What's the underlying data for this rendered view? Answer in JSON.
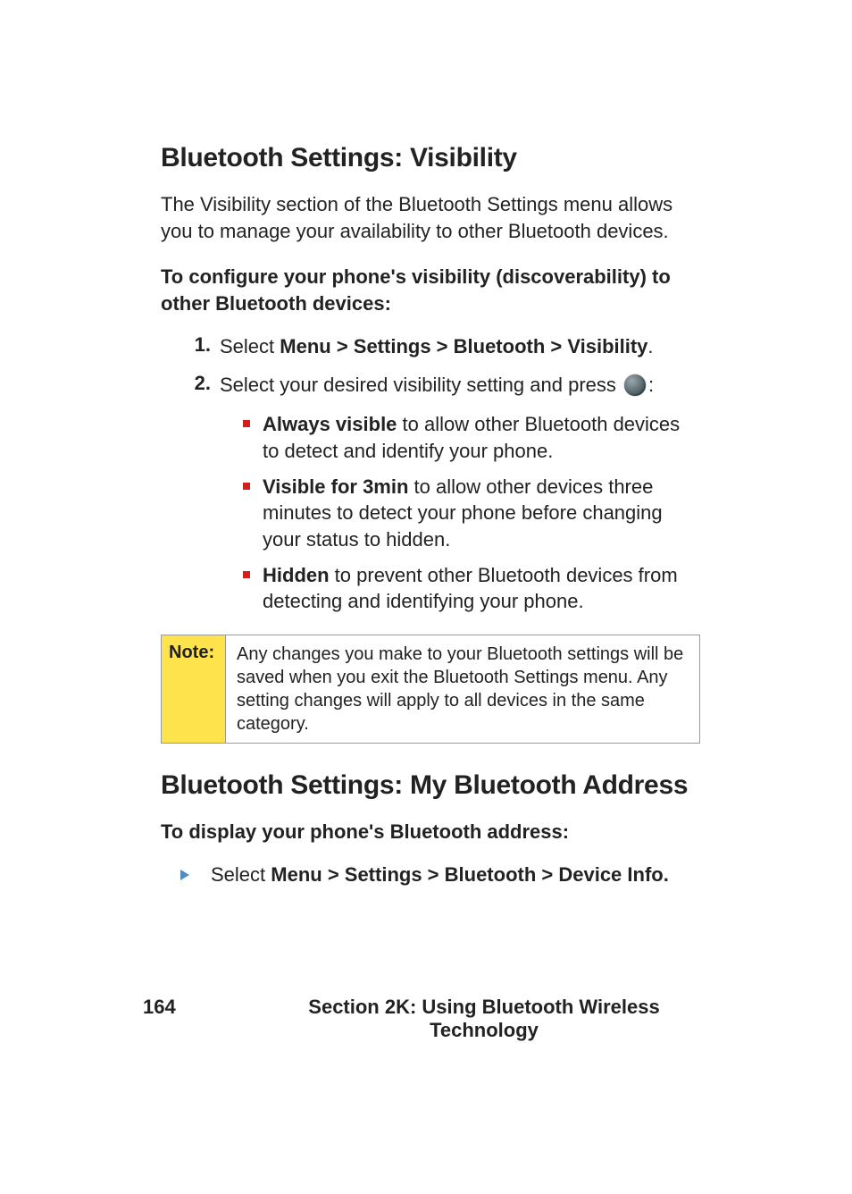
{
  "section1": {
    "heading": "Bluetooth Settings: Visibility",
    "intro": "The Visibility section of the Bluetooth Settings menu allows you to manage your availability to other Bluetooth devices.",
    "subheading": "To configure your phone's visibility (discoverability) to other Bluetooth devices:",
    "steps": [
      {
        "num": "1.",
        "prefix": "Select ",
        "bold": "Menu > Settings > Bluetooth > Visibility",
        "suffix": "."
      },
      {
        "num": "2.",
        "prefix": "Select your desired visibility setting and press ",
        "bold": "",
        "suffix": ":",
        "has_ok_icon": true
      }
    ],
    "bullets": [
      {
        "bold": "Always visible",
        "rest": " to allow other Bluetooth devices to detect and identify your phone."
      },
      {
        "bold": "Visible for 3min",
        "rest": " to allow other devices three minutes to detect your phone before changing your status to hidden."
      },
      {
        "bold": "Hidden",
        "rest": " to prevent other Bluetooth devices from detecting and identifying your phone."
      }
    ],
    "note": {
      "label": "Note:",
      "text": "Any changes you make to your Bluetooth settings will be saved when you exit the Bluetooth Settings menu. Any setting changes will apply to all devices in the same category."
    }
  },
  "section2": {
    "heading": "Bluetooth Settings: My Bluetooth Address",
    "subheading": "To display your phone's Bluetooth address:",
    "bullet": {
      "prefix": "Select ",
      "bold": "Menu > Settings > Bluetooth > Device Info."
    }
  },
  "footer": {
    "page_num": "164",
    "title": "Section 2K: Using Bluetooth Wireless Technology"
  }
}
